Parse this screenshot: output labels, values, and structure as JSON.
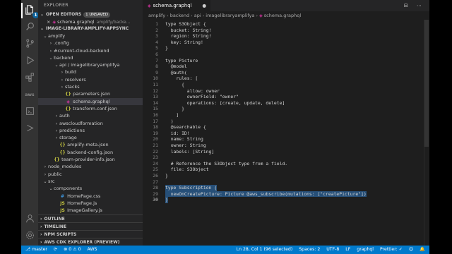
{
  "sidebar": {
    "title": "EXPLORER",
    "open_editors": {
      "label": "OPEN EDITORS",
      "badge": "1 UNSAVED",
      "items": [
        {
          "name": "schema.graphql",
          "path": "amplify/backe..."
        }
      ]
    },
    "project": {
      "label": "IMAGE-LIBRARY-AMPLIFY-APPSYNC",
      "tree": [
        {
          "label": "amplify",
          "depth": 0,
          "chevron": "⌄",
          "icon": ""
        },
        {
          "label": ".config",
          "depth": 1,
          "chevron": "›",
          "icon": ""
        },
        {
          "label": "#current-cloud-backend",
          "depth": 1,
          "chevron": "›",
          "icon": ""
        },
        {
          "label": "backend",
          "depth": 1,
          "chevron": "⌄",
          "icon": ""
        },
        {
          "label": "api / imagelibraryamplifya",
          "depth": 2,
          "chevron": "⌄",
          "icon": ""
        },
        {
          "label": "build",
          "depth": 3,
          "chevron": "›",
          "icon": ""
        },
        {
          "label": "resolvers",
          "depth": 3,
          "chevron": "›",
          "icon": ""
        },
        {
          "label": "stacks",
          "depth": 3,
          "chevron": "›",
          "icon": ""
        },
        {
          "label": "parameters.json",
          "depth": 3,
          "chevron": "",
          "icon": "{}"
        },
        {
          "label": "schema.graphql",
          "depth": 3,
          "chevron": "",
          "icon": "◈",
          "selected": true
        },
        {
          "label": "transform.conf.json",
          "depth": 3,
          "chevron": "",
          "icon": "{}"
        },
        {
          "label": "auth",
          "depth": 2,
          "chevron": "›",
          "icon": ""
        },
        {
          "label": "awscloudformation",
          "depth": 2,
          "chevron": "›",
          "icon": ""
        },
        {
          "label": "predictions",
          "depth": 2,
          "chevron": "›",
          "icon": ""
        },
        {
          "label": "storage",
          "depth": 2,
          "chevron": "›",
          "icon": ""
        },
        {
          "label": "amplify-meta.json",
          "depth": 2,
          "chevron": "",
          "icon": "{}"
        },
        {
          "label": "backend-config.json",
          "depth": 2,
          "chevron": "",
          "icon": "{}"
        },
        {
          "label": "team-provider-info.json",
          "depth": 1,
          "chevron": "",
          "icon": "{}"
        },
        {
          "label": "node_modules",
          "depth": 0,
          "chevron": "›",
          "icon": ""
        },
        {
          "label": "public",
          "depth": 0,
          "chevron": "›",
          "icon": ""
        },
        {
          "label": "src",
          "depth": 0,
          "chevron": "⌄",
          "icon": ""
        },
        {
          "label": "components",
          "depth": 1,
          "chevron": "⌄",
          "icon": ""
        },
        {
          "label": "HomePage.css",
          "depth": 2,
          "chevron": "",
          "icon": "#"
        },
        {
          "label": "HomePage.js",
          "depth": 2,
          "chevron": "",
          "icon": "JS"
        },
        {
          "label": "ImageGallery.js",
          "depth": 2,
          "chevron": "",
          "icon": "JS"
        }
      ]
    },
    "bottom_sections": [
      "OUTLINE",
      "TIMELINE",
      "NPM SCRIPTS",
      "AWS CDK EXPLORER (PREVIEW)"
    ]
  },
  "activity_bar": {
    "icons": [
      "files-icon",
      "search-icon",
      "source-control-icon",
      "run-debug-icon",
      "extensions-icon",
      "aws-icon",
      "remote-icon",
      "docker-icon"
    ],
    "explorer_badge": "1"
  },
  "tab": {
    "label": "schema.graphql",
    "modified": "●"
  },
  "tab_actions": "⊟ ⋯",
  "breadcrumb": [
    "amplify",
    "backend",
    "api",
    "imagelibraryamplifya",
    "schema.graphql"
  ],
  "editor": {
    "lines": [
      {
        "n": "1",
        "text": "type S3Object {"
      },
      {
        "n": "2",
        "text": "  bucket: String!"
      },
      {
        "n": "3",
        "text": "  region: String!"
      },
      {
        "n": "4",
        "text": "  key: String!"
      },
      {
        "n": "5",
        "text": "}"
      },
      {
        "n": "6",
        "text": ""
      },
      {
        "n": "7",
        "text": "type Picture"
      },
      {
        "n": "8",
        "text": "  @model"
      },
      {
        "n": "9",
        "text": "  @auth("
      },
      {
        "n": "10",
        "text": "    rules: ["
      },
      {
        "n": "11",
        "text": "      {"
      },
      {
        "n": "12",
        "text": "        allow: owner"
      },
      {
        "n": "13",
        "text": "        ownerField: \"owner\""
      },
      {
        "n": "14",
        "text": "        operations: [create, update, delete]"
      },
      {
        "n": "15",
        "text": "      }"
      },
      {
        "n": "16",
        "text": "    ]"
      },
      {
        "n": "17",
        "text": "  )"
      },
      {
        "n": "18",
        "text": "  @searchable {"
      },
      {
        "n": "19",
        "text": "  id: ID!"
      },
      {
        "n": "20",
        "text": "  name: String"
      },
      {
        "n": "21",
        "text": "  owner: String"
      },
      {
        "n": "22",
        "text": "  labels: [String]"
      },
      {
        "n": "23",
        "text": ""
      },
      {
        "n": "24",
        "text": "  # Reference the S3Object type from a field."
      },
      {
        "n": "25",
        "text": "  file: S3Object"
      },
      {
        "n": "26",
        "text": "}"
      },
      {
        "n": "27",
        "text": ""
      },
      {
        "n": "28",
        "text": "type Subscription {",
        "selected": true
      },
      {
        "n": "29",
        "text": "  newOnCreatePicture: Picture @aws_subscribe(mutations: [\"createPicture\"])",
        "selected": true
      },
      {
        "n": "30",
        "text": "}",
        "selected": true,
        "current": true
      }
    ]
  },
  "status_bar": {
    "branch": "master",
    "sync": "⟳",
    "problems": "⊗ 0  ⚠ 0",
    "aws": "AWS",
    "position": "Ln 28, Col 1 (96 selected)",
    "spaces": "Spaces: 2",
    "encoding": "UTF-8",
    "eol": "LF",
    "language": "graphql",
    "prettier": "Prettier: ✓",
    "feedback": "☺",
    "bell": "🔔"
  }
}
